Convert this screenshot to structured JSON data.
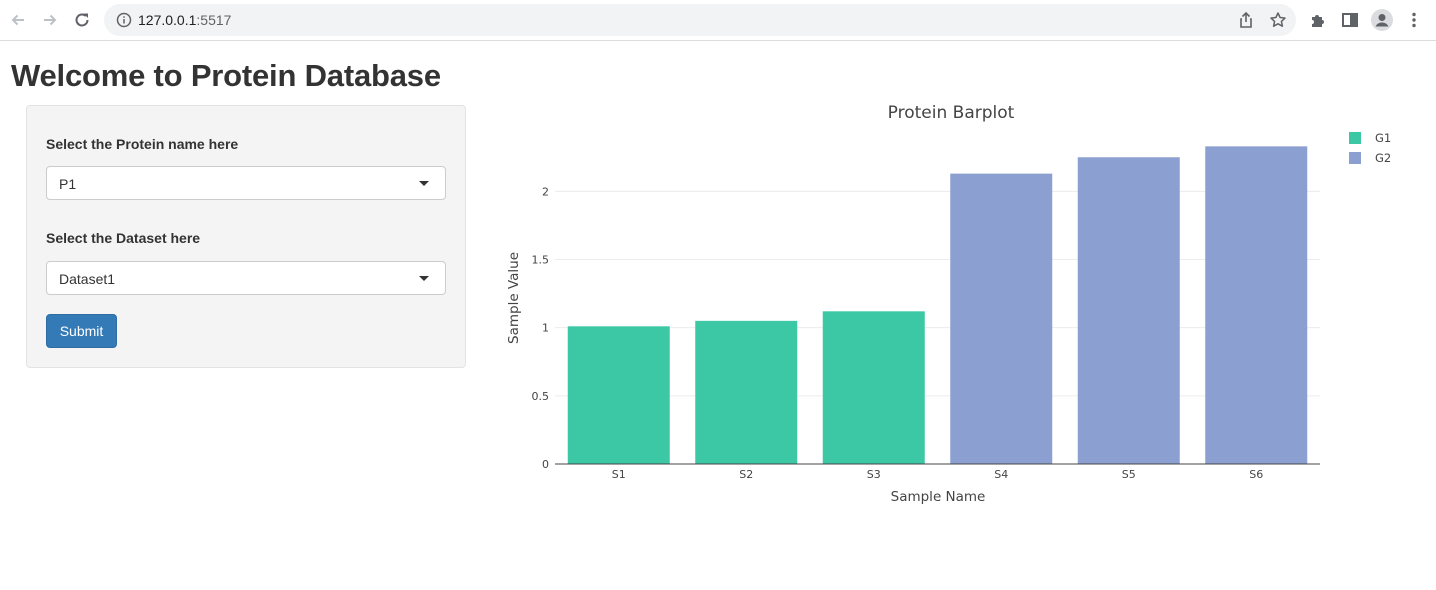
{
  "browser": {
    "url_host": "127.0.0.1",
    "url_port": ":5517",
    "icons": [
      "back-arrow-icon",
      "forward-arrow-icon",
      "reload-icon",
      "info-icon",
      "share-icon",
      "star-icon",
      "extensions-icon",
      "side-panel-icon",
      "profile-icon",
      "menu-dots-icon"
    ]
  },
  "page": {
    "title": "Welcome to Protein Database"
  },
  "form": {
    "protein_label": "Select the Protein name here",
    "protein_value": "P1",
    "dataset_label": "Select the Dataset here",
    "dataset_value": "Dataset1",
    "submit_label": "Submit"
  },
  "chart_data": {
    "type": "bar",
    "title": "Protein Barplot",
    "xlabel": "Sample Name",
    "ylabel": "Sample Value",
    "categories": [
      "S1",
      "S2",
      "S3",
      "S4",
      "S5",
      "S6"
    ],
    "series": [
      {
        "name": "G1",
        "color": "#3cc8a5",
        "values": {
          "S1": 1.01,
          "S2": 1.05,
          "S3": 1.12
        }
      },
      {
        "name": "G2",
        "color": "#8b9fd0",
        "values": {
          "S4": 2.13,
          "S5": 2.25,
          "S6": 2.33
        }
      }
    ],
    "yticks": [
      0,
      0.5,
      1,
      1.5,
      2
    ],
    "ytick_labels": [
      "0",
      "0.5",
      "1",
      "1.5",
      "2"
    ],
    "ylim": [
      0,
      2.45
    ],
    "grid": true,
    "legend_position": "top-right"
  }
}
